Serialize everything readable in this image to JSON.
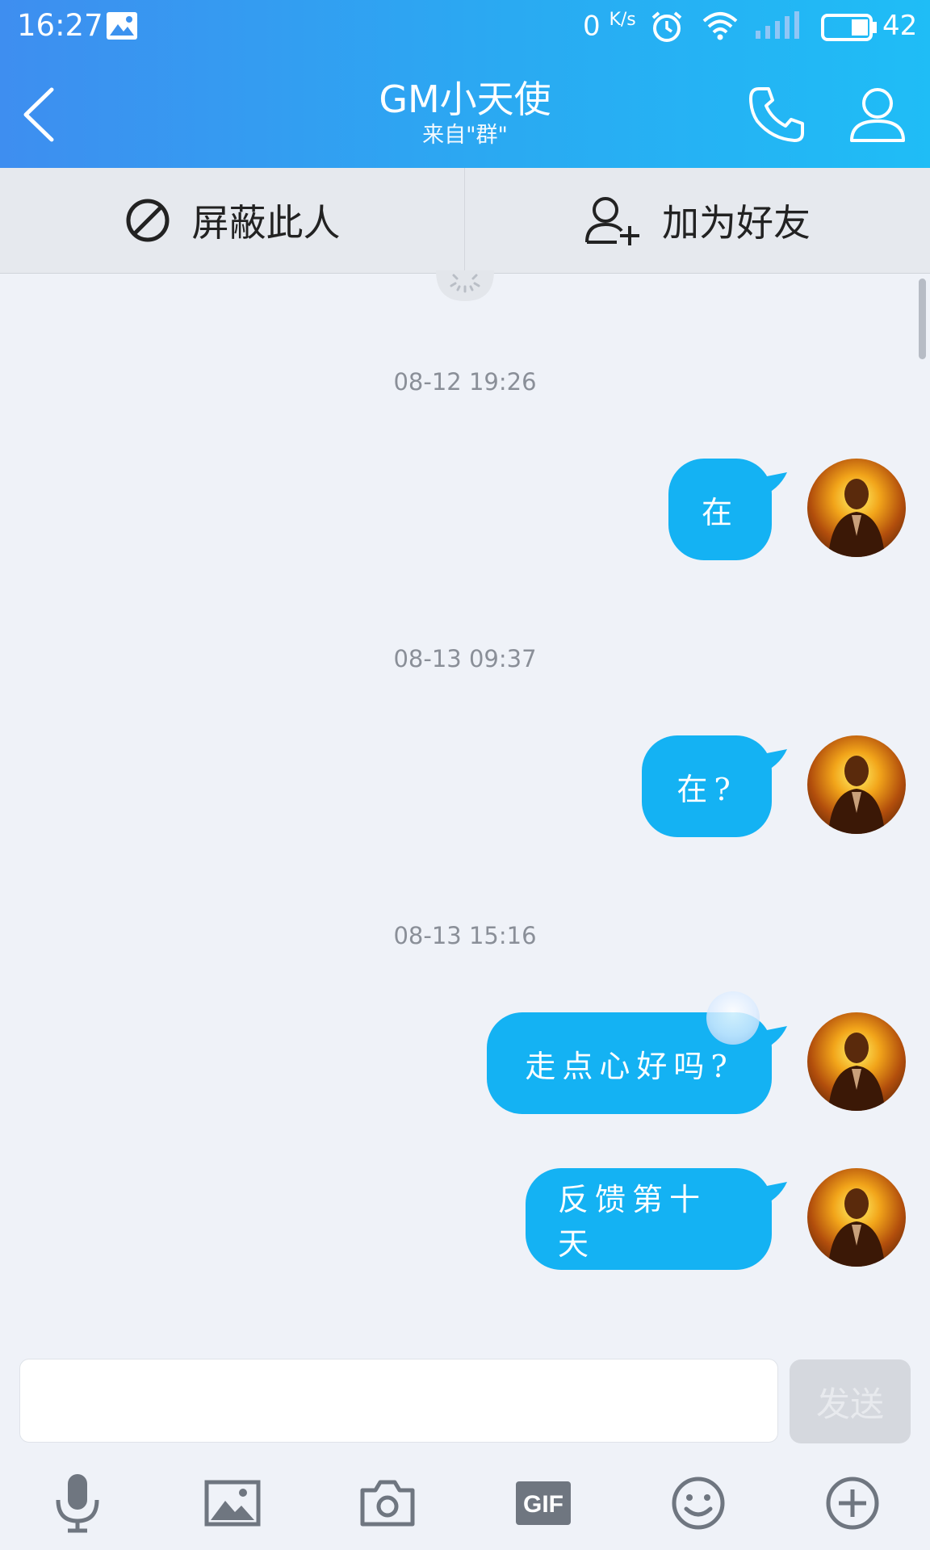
{
  "status_bar": {
    "time": "16:27",
    "net_speed_value": "0",
    "net_speed_unit": "K/s",
    "battery_level": "42"
  },
  "header": {
    "title": "GM小天使",
    "subtitle": "来自\"群\""
  },
  "actions": {
    "block_label": "屏蔽此人",
    "add_friend_label": "加为好友"
  },
  "messages": [
    {
      "timestamp": "08-12 19:26",
      "text": "在"
    },
    {
      "timestamp": "08-13 09:37",
      "text": "在?"
    },
    {
      "timestamp": "08-13 15:16",
      "text": "走点心好吗?"
    },
    {
      "timestamp": "",
      "text": "反馈第十天"
    }
  ],
  "input": {
    "placeholder": "",
    "send_label": "发送"
  },
  "toolbar": {
    "icons": [
      "microphone-icon",
      "image-icon",
      "camera-icon",
      "gif-icon",
      "emoji-icon",
      "plus-icon"
    ],
    "gif_label": "GIF"
  },
  "colors": {
    "header_start": "#3e8ef0",
    "header_end": "#1fbdf6",
    "bubble": "#14b2f3",
    "background": "#eff2f8"
  }
}
